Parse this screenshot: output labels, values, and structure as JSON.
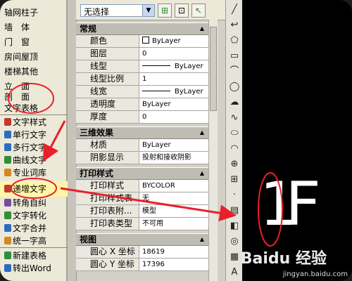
{
  "left_menu": {
    "items_top": [
      "轴网柱子",
      "墙　体",
      "门　窗",
      "房间屋顶",
      "楼梯其他",
      "立　面",
      "剖　面",
      "文字表格"
    ],
    "items_sub": [
      "文字样式",
      "单行文字",
      "多行文字",
      "曲线文字",
      "专业词库",
      "递增文字",
      "转角自纠",
      "文字转化",
      "文字合并",
      "统一字高",
      "新建表格",
      "转出Word"
    ],
    "highlighted": "递增文字"
  },
  "props_panel": {
    "selector_value": "无选择",
    "sections": {
      "general": {
        "title": "常规",
        "rows": [
          {
            "k": "颜色",
            "v": "ByLayer"
          },
          {
            "k": "图层",
            "v": "0"
          },
          {
            "k": "线型",
            "v": "ByLayer"
          },
          {
            "k": "线型比例",
            "v": "1"
          },
          {
            "k": "线宽",
            "v": "ByLayer"
          },
          {
            "k": "透明度",
            "v": "ByLayer"
          },
          {
            "k": "厚度",
            "v": "0"
          }
        ]
      },
      "3d": {
        "title": "三维效果",
        "rows": [
          {
            "k": "材质",
            "v": "ByLayer"
          },
          {
            "k": "阴影显示",
            "v": "投射和接收阴影"
          }
        ]
      },
      "print": {
        "title": "打印样式",
        "rows": [
          {
            "k": "打印样式",
            "v": "BYCOLOR"
          },
          {
            "k": "打印样式表",
            "v": "无"
          },
          {
            "k": "打印表附...",
            "v": "模型"
          },
          {
            "k": "打印表类型",
            "v": "不可用"
          }
        ]
      },
      "view": {
        "title": "视图",
        "rows": [
          {
            "k": "圆心 X 坐标",
            "v": "18619"
          },
          {
            "k": "圆心 Y 坐标",
            "v": "17396"
          }
        ]
      }
    }
  },
  "canvas": {
    "text_1": "1",
    "text_2": "F"
  },
  "watermark": {
    "text": "jingyan.baidu.com",
    "logo": "Baidu 经验"
  },
  "colors": {
    "annotation": "#e8202a",
    "canvas_bg": "#000000",
    "panel_bg": "#d4d0c8"
  }
}
